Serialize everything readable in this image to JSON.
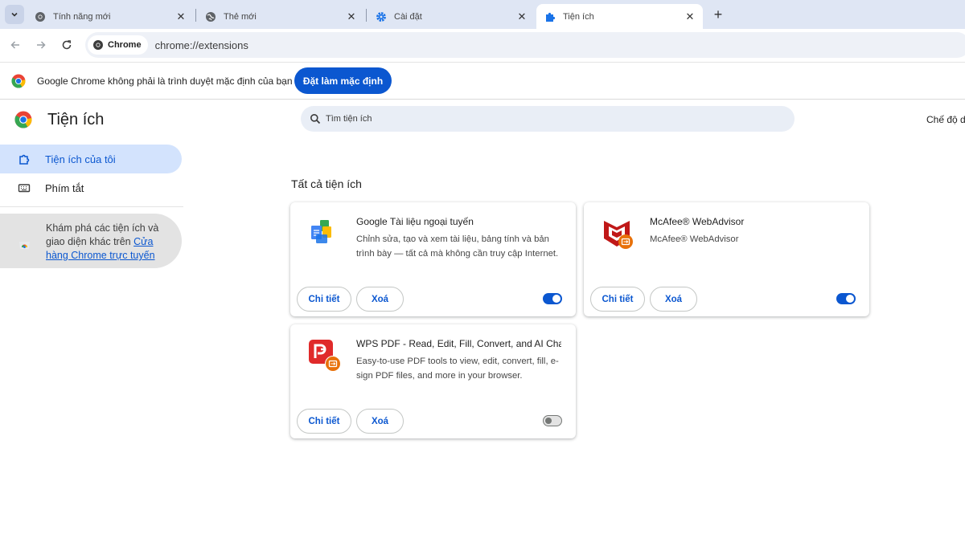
{
  "tabs": [
    {
      "title": "Tính năng mới",
      "icon": "chrome-icon"
    },
    {
      "title": "Thẻ mới",
      "icon": "globe-icon"
    },
    {
      "title": "Cài đặt",
      "icon": "gear-icon"
    },
    {
      "title": "Tiện ích",
      "icon": "puzzle-icon",
      "active": true
    }
  ],
  "toolbar": {
    "site_chip": "Chrome",
    "url": "chrome://extensions"
  },
  "infobar": {
    "message": "Google Chrome không phải là trình duyệt mặc định của bạn",
    "button": "Đặt làm mặc định"
  },
  "page": {
    "title": "Tiện ích",
    "search_placeholder": "Tìm tiện ích",
    "dev_mode_label": "Chế độ dà"
  },
  "sidebar": {
    "items": [
      {
        "label": "Tiện ích của tôi",
        "icon": "extension-icon",
        "selected": true
      },
      {
        "label": "Phím tắt",
        "icon": "keyboard-icon"
      }
    ],
    "promo_text": "Khám phá các tiện ích và giao diện khác trên ",
    "promo_link": "Cửa hàng Chrome trực tuyến"
  },
  "section_title": "Tất cả tiện ích",
  "extensions": [
    {
      "name": "Google Tài liệu ngoại tuyến",
      "description": "Chỉnh sửa, tạo và xem tài liệu, bảng tính và bản trình bày — tất cả mà không cần truy cập Internet.",
      "details_label": "Chi tiết",
      "remove_label": "Xoá",
      "enabled": true,
      "icon": "google-docs-offline-icon"
    },
    {
      "name": "McAfee® WebAdvisor",
      "description": "McAfee® WebAdvisor",
      "details_label": "Chi tiết",
      "remove_label": "Xoá",
      "enabled": true,
      "icon": "mcafee-icon"
    },
    {
      "name": "WPS PDF - Read, Edit, Fill, Convert, and AI Chat...",
      "description": "Easy-to-use PDF tools to view, edit, convert, fill, e-sign PDF files, and more in your browser.",
      "details_label": "Chi tiết",
      "remove_label": "Xoá",
      "enabled": false,
      "icon": "wps-pdf-icon"
    }
  ],
  "colors": {
    "accent": "#0b57d0",
    "tabstrip": "#dfe6f4",
    "selected_nav": "#d3e3fd"
  }
}
